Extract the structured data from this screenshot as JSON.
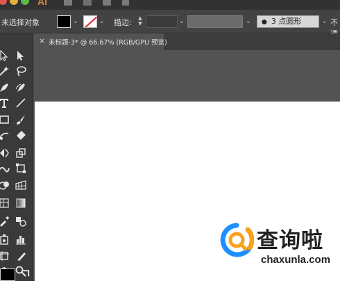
{
  "app": {
    "logo_text": "Ai"
  },
  "control_bar": {
    "selection_status": "未选择对象",
    "stroke_label": "描边:",
    "brush_label": "3 点圆形",
    "opacity_label": "不透"
  },
  "document_tab": {
    "close_glyph": "×",
    "title": "未标题-3* @ 66.67% (RGB/GPU 预览)"
  },
  "watermark": {
    "title": "查询啦",
    "url": "chaxunla.com"
  },
  "colors": {
    "panel": "#3a3a3a",
    "workspace": "#535353",
    "artboard": "#ffffff",
    "accent_blue": "#1f8fff",
    "accent_orange": "#f7a21b"
  }
}
